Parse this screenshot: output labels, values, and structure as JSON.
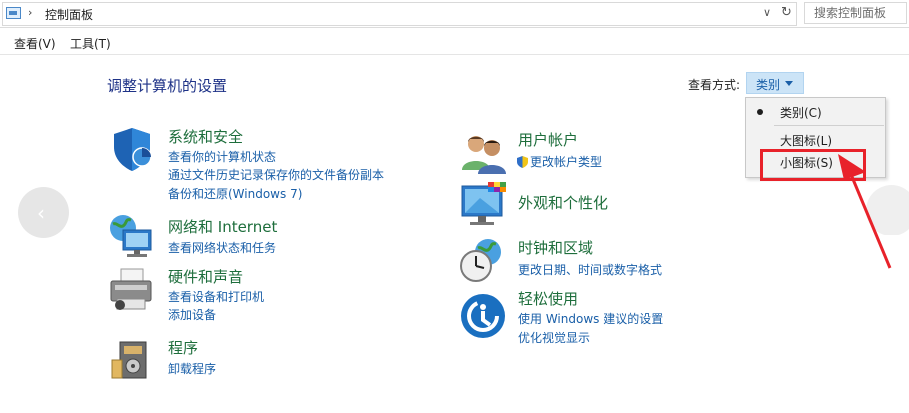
{
  "address_bar": {
    "breadcrumb": "控制面板",
    "separator": "›",
    "search_placeholder": "搜索控制面板"
  },
  "menu": {
    "items": [
      "查看(V)",
      "工具(T)"
    ]
  },
  "main": {
    "title": "调整计算机的设置",
    "view_by_label": "查看方式:",
    "view_by_value": "类别"
  },
  "dropdown": {
    "items": [
      {
        "label": "类别(C)",
        "selected": true
      },
      {
        "label": "大图标(L)",
        "selected": false
      },
      {
        "label": "小图标(S)",
        "selected": false
      }
    ],
    "highlighted_item": "小图标(S)",
    "annotation_color": "#e8222a"
  },
  "categories_left": [
    {
      "title": "系统和安全",
      "icon": "security-shield-icon",
      "links": [
        "查看你的计算机状态",
        "通过文件历史记录保存你的文件备份副本",
        "备份和还原(Windows 7)"
      ]
    },
    {
      "title": "网络和 Internet",
      "icon": "network-globe-icon",
      "links": [
        "查看网络状态和任务"
      ]
    },
    {
      "title": "硬件和声音",
      "icon": "printer-icon",
      "links": [
        "查看设备和打印机",
        "添加设备"
      ]
    },
    {
      "title": "程序",
      "icon": "programs-box-icon",
      "links": [
        "卸载程序"
      ]
    }
  ],
  "categories_right": [
    {
      "title": "用户帐户",
      "icon": "users-icon",
      "links": [
        "更改帐户类型"
      ]
    },
    {
      "title": "外观和个性化",
      "icon": "monitor-palette-icon",
      "links": []
    },
    {
      "title": "时钟和区域",
      "icon": "clock-globe-icon",
      "links": [
        "更改日期、时间或数字格式"
      ]
    },
    {
      "title": "轻松使用",
      "icon": "ease-of-access-icon",
      "links": [
        "使用 Windows 建议的设置",
        "优化视觉显示"
      ]
    }
  ],
  "colors": {
    "link": "#1a5fa8",
    "category_title": "#1e6e3c",
    "page_title": "#1e3287",
    "dropdown_button_bg": "#cce4f7"
  }
}
